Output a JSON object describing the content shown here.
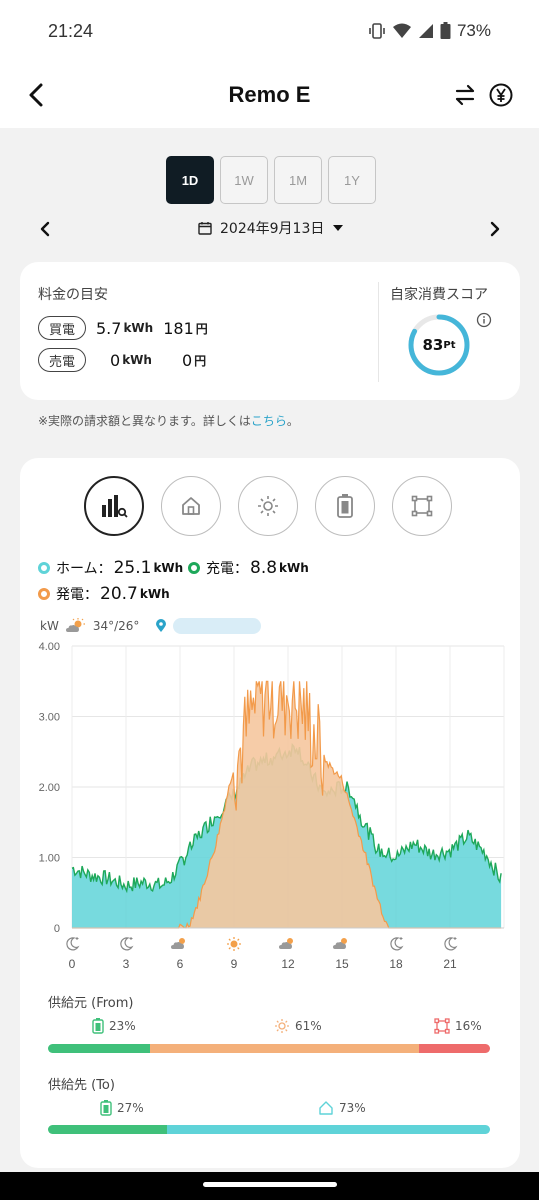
{
  "status": {
    "time": "21:24",
    "battery": "73%"
  },
  "header": {
    "title": "Remo E"
  },
  "range_tabs": [
    "1D",
    "1W",
    "1M",
    "1Y"
  ],
  "date": "2024年9月13日",
  "summary": {
    "label": "料金の目安",
    "buy": {
      "tag": "買電",
      "kwh": "5.7",
      "kwh_unit": "kWh",
      "yen": "181",
      "yen_unit": "円"
    },
    "sell": {
      "tag": "売電",
      "kwh": "0",
      "kwh_unit": "kWh",
      "yen": "0",
      "yen_unit": "円"
    },
    "score_label": "自家消費スコア",
    "score": "83",
    "score_unit": "Pt"
  },
  "note": {
    "text": "※実際の請求額と異なります。詳しくは",
    "link": "こちら",
    "end": "。"
  },
  "legend": {
    "home": {
      "label": "ホーム：",
      "value": "25.1",
      "unit": "kWh"
    },
    "charge": {
      "label": "充電：",
      "value": "8.8",
      "unit": "kWh"
    },
    "gen": {
      "label": "発電：",
      "value": "20.7",
      "unit": "kWh"
    }
  },
  "weather": {
    "unit": "kW",
    "temp": "34°/26°"
  },
  "colors": {
    "home": "#5fd3d8",
    "charge": "#1ea85a",
    "gen": "#f29a4a",
    "gen_fill": "#f5c79f",
    "grid": "#e85a5a"
  },
  "chart_data": {
    "type": "area",
    "ylim": [
      0,
      4
    ],
    "yticks": [
      "4.00",
      "3.00",
      "2.00",
      "1.00",
      "0"
    ],
    "xticks": [
      "0",
      "3",
      "6",
      "9",
      "12",
      "15",
      "18",
      "21"
    ],
    "xtick_icons": [
      "moon-icon",
      "moon-icon",
      "partly-cloudy-icon",
      "sun-icon",
      "partly-cloudy-icon",
      "partly-cloudy-icon",
      "moon-icon",
      "moon-icon"
    ],
    "series": [
      {
        "name": "ホーム",
        "x": [
          0,
          1,
          2,
          3,
          4,
          5,
          5.5,
          6,
          7,
          8,
          9,
          10,
          11,
          12,
          12.5,
          13,
          14,
          15,
          15.5,
          16,
          17,
          18,
          19,
          20,
          21,
          22,
          23,
          23.9
        ],
        "y": [
          0.85,
          0.75,
          0.7,
          0.6,
          0.65,
          0.6,
          0.7,
          0.9,
          1.3,
          1.6,
          1.9,
          2.3,
          2.4,
          2.5,
          2.6,
          2.3,
          1.9,
          2.0,
          1.95,
          1.6,
          1.1,
          1.0,
          1.2,
          1.05,
          1.1,
          1.3,
          1.05,
          0.65
        ]
      },
      {
        "name": "発電",
        "x": [
          0,
          6,
          6.5,
          7,
          8,
          9,
          9.5,
          10,
          10.5,
          11,
          11.5,
          12,
          12.5,
          13,
          13.5,
          14,
          15,
          16,
          17,
          17.5,
          18,
          24
        ],
        "y": [
          0,
          0,
          0.05,
          0.35,
          1.2,
          2.3,
          2.7,
          3.1,
          3.4,
          3.45,
          3.35,
          3.4,
          3.3,
          3.1,
          2.8,
          2.4,
          2.1,
          1.3,
          0.4,
          0.05,
          0,
          0
        ]
      }
    ]
  },
  "supply_from": {
    "title": "供給元 (From)",
    "items": [
      {
        "icon": "battery-icon",
        "value": "23%",
        "pct": 23,
        "color": "#3fc07a"
      },
      {
        "icon": "sun-icon",
        "value": "61%",
        "pct": 61,
        "color": "#f4b07a"
      },
      {
        "icon": "grid-icon",
        "value": "16%",
        "pct": 16,
        "color": "#ee6b6b"
      }
    ]
  },
  "supply_to": {
    "title": "供給先 (To)",
    "items": [
      {
        "icon": "battery-icon",
        "value": "27%",
        "pct": 27,
        "color": "#3fc07a"
      },
      {
        "icon": "home-icon",
        "value": "73%",
        "pct": 73,
        "color": "#5fd3d8"
      }
    ]
  }
}
